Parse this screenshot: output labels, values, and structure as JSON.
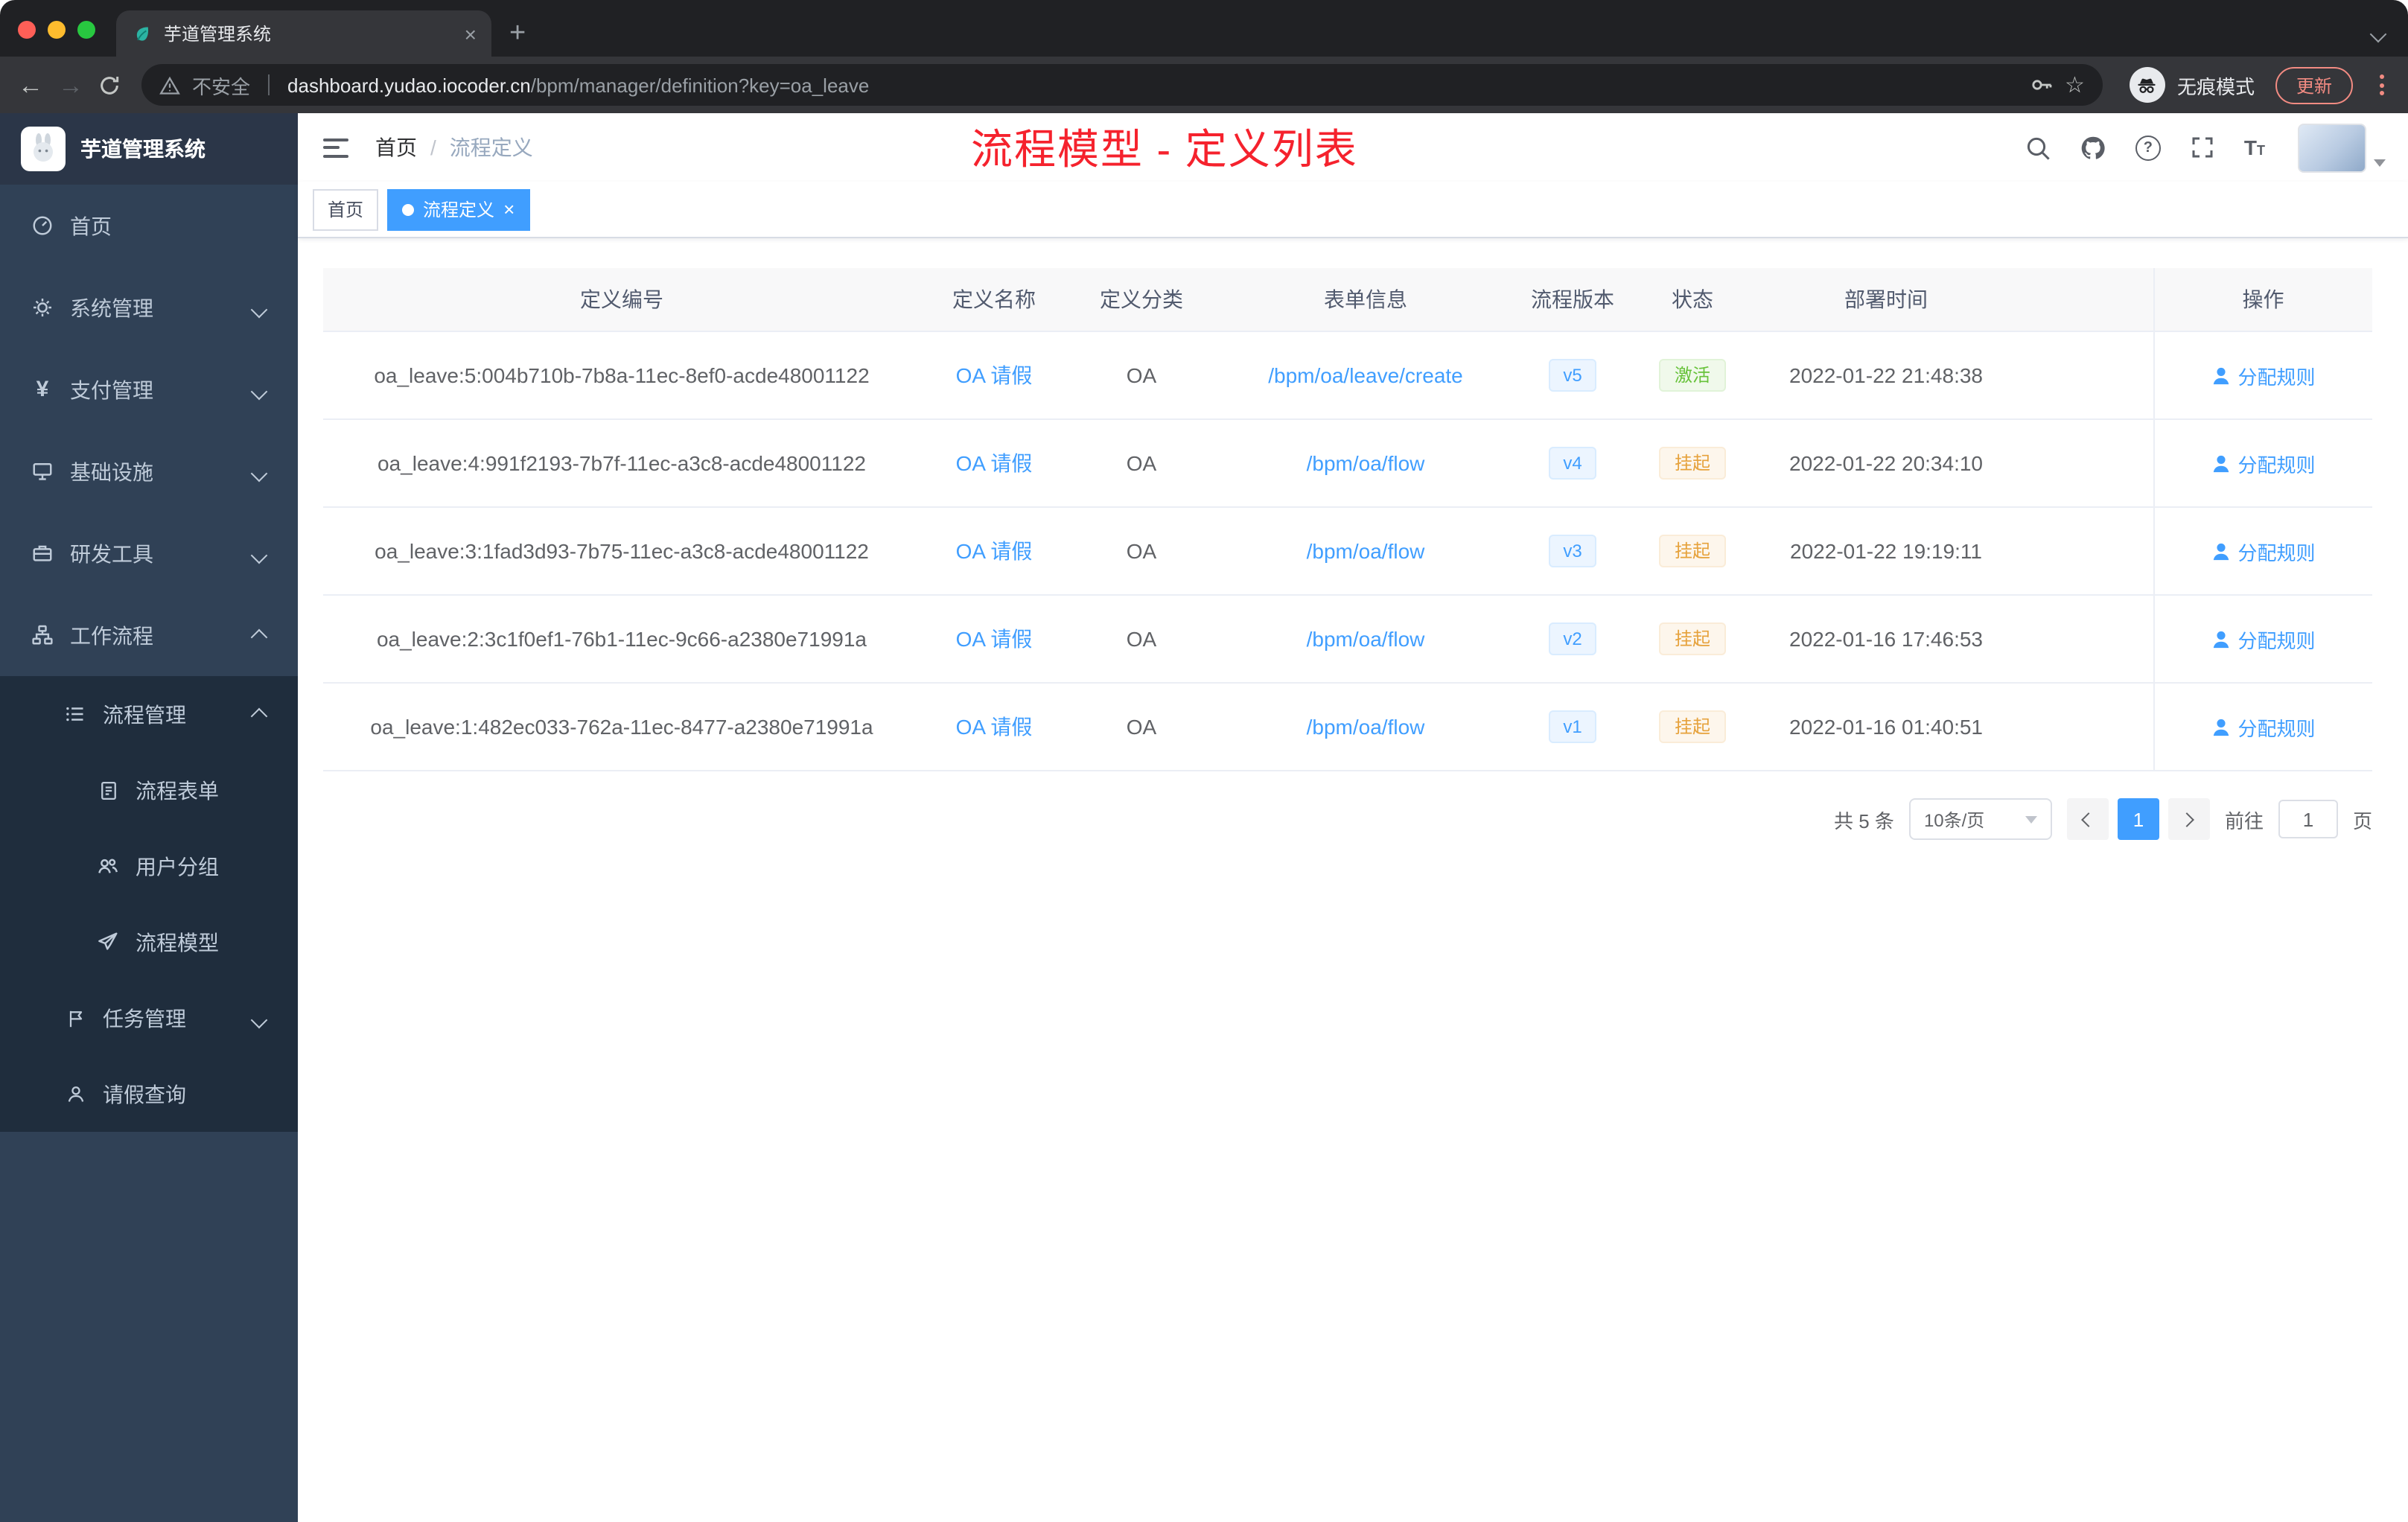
{
  "colors": {
    "accent": "#409eff",
    "annotation_red": "#f5222d",
    "status_active_green": "#67c23a",
    "status_suspended_orange": "#e6a23c",
    "sidebar_bg": "#304156",
    "submenu_bg": "#1f2d3d"
  },
  "glyphs": {
    "tab_close": "×",
    "new_tab": "+",
    "back_arrow": "←",
    "forward_arrow": "→",
    "star": "☆",
    "breadcrumb_separator": "/",
    "tag_close": "×",
    "help_mark": "?",
    "font_big": "T",
    "font_small": "T",
    "yen": "¥"
  },
  "browser": {
    "tab_title": "芋道管理系统",
    "security_label": "不安全",
    "url_domain": "dashboard.yudao.iocoder.cn",
    "url_path": "/bpm/manager/definition?key=oa_leave",
    "incognito_label": "无痕模式",
    "update_label": "更新"
  },
  "sidebar": {
    "logo_title": "芋道管理系统",
    "items": [
      {
        "label": "首页",
        "icon": "dashboard-icon",
        "level": 1
      },
      {
        "label": "系统管理",
        "icon": "gear-icon",
        "level": 1,
        "chevron": "down"
      },
      {
        "label": "支付管理",
        "icon": "payment-icon",
        "level": 1,
        "chevron": "down"
      },
      {
        "label": "基础设施",
        "icon": "infrastructure-icon",
        "level": 1,
        "chevron": "down"
      },
      {
        "label": "研发工具",
        "icon": "devtools-icon",
        "level": 1,
        "chevron": "down"
      },
      {
        "label": "工作流程",
        "icon": "workflow-icon",
        "level": 1,
        "chevron": "up"
      },
      {
        "label": "流程管理",
        "icon": "process-list-icon",
        "level": 2,
        "chevron": "up"
      },
      {
        "label": "流程表单",
        "icon": "form-icon",
        "level": 3
      },
      {
        "label": "用户分组",
        "icon": "user-group-icon",
        "level": 3
      },
      {
        "label": "流程模型",
        "icon": "paper-plane-icon",
        "level": 3
      },
      {
        "label": "任务管理",
        "icon": "task-flag-icon",
        "level": 2,
        "chevron": "down"
      },
      {
        "label": "请假查询",
        "icon": "person-icon",
        "level": 2
      }
    ]
  },
  "header": {
    "breadcrumb_home": "首页",
    "breadcrumb_current": "流程定义",
    "annotation": "流程模型 - 定义列表"
  },
  "tags": {
    "home": "首页",
    "active": "流程定义"
  },
  "table": {
    "columns": [
      "定义编号",
      "定义名称",
      "定义分类",
      "表单信息",
      "流程版本",
      "状态",
      "部署时间",
      "操作"
    ],
    "rows": [
      {
        "id": "oa_leave:5:004b710b-7b8a-11ec-8ef0-acde48001122",
        "name": "OA 请假",
        "category": "OA",
        "form": "/bpm/oa/leave/create",
        "version": "v5",
        "status": "激活",
        "time": "2022-01-22 21:48:38",
        "action": "分配规则"
      },
      {
        "id": "oa_leave:4:991f2193-7b7f-11ec-a3c8-acde48001122",
        "name": "OA 请假",
        "category": "OA",
        "form": "/bpm/oa/flow",
        "version": "v4",
        "status": "挂起",
        "time": "2022-01-22 20:34:10",
        "action": "分配规则"
      },
      {
        "id": "oa_leave:3:1fad3d93-7b75-11ec-a3c8-acde48001122",
        "name": "OA 请假",
        "category": "OA",
        "form": "/bpm/oa/flow",
        "version": "v3",
        "status": "挂起",
        "time": "2022-01-22 19:19:11",
        "action": "分配规则"
      },
      {
        "id": "oa_leave:2:3c1f0ef1-76b1-11ec-9c66-a2380e71991a",
        "name": "OA 请假",
        "category": "OA",
        "form": "/bpm/oa/flow",
        "version": "v2",
        "status": "挂起",
        "time": "2022-01-16 17:46:53",
        "action": "分配规则"
      },
      {
        "id": "oa_leave:1:482ec033-762a-11ec-8477-a2380e71991a",
        "name": "OA 请假",
        "category": "OA",
        "form": "/bpm/oa/flow",
        "version": "v1",
        "status": "挂起",
        "time": "2022-01-16 01:40:51",
        "action": "分配规则"
      }
    ]
  },
  "pagination": {
    "total": "共 5 条",
    "page_size": "10条/页",
    "page": "1",
    "goto_label": "前往",
    "goto_value": "1",
    "unit": "页"
  }
}
